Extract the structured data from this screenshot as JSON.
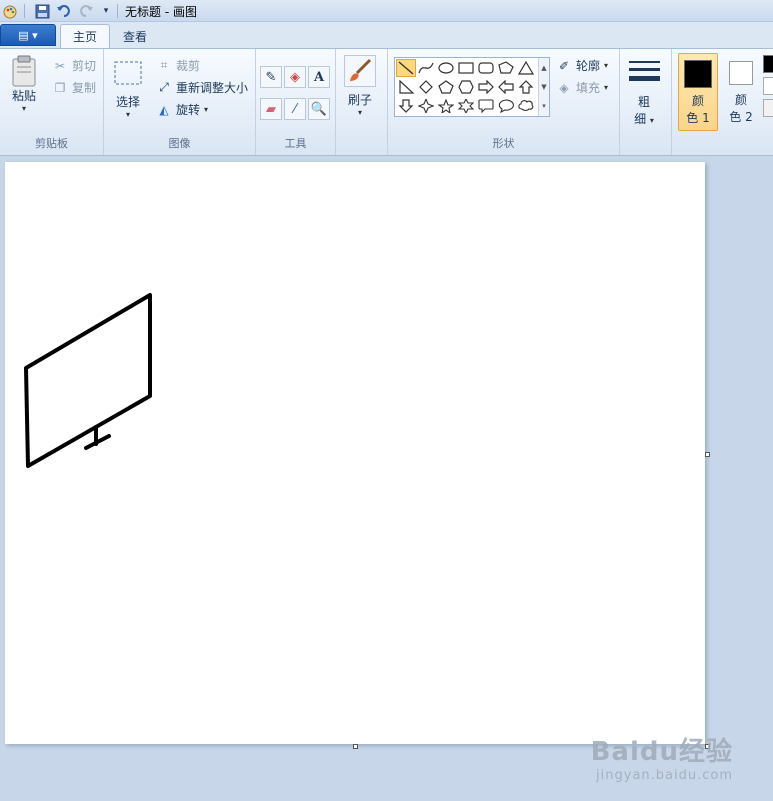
{
  "window": {
    "title": "无标题 - 画图"
  },
  "tabs": [
    {
      "label": "主页"
    },
    {
      "label": "查看"
    }
  ],
  "ribbon": {
    "clipboard": {
      "label": "剪贴板",
      "paste": "粘贴",
      "cut": "剪切",
      "copy": "复制"
    },
    "image": {
      "label": "图像",
      "select": "选择",
      "crop": "裁剪",
      "resize": "重新调整大小",
      "rotate": "旋转"
    },
    "tools": {
      "label": "工具"
    },
    "brushes": {
      "label": "刷子"
    },
    "shapes": {
      "label": "形状",
      "outline": "轮廓",
      "fill": "填充"
    },
    "size": {
      "label_line1": "粗",
      "label_line2": "细"
    },
    "color1": {
      "line1": "颜",
      "line2": "色 1",
      "value": "#000000"
    },
    "color2": {
      "line1": "颜",
      "line2": "色 2",
      "value": "#ffffff"
    }
  },
  "drawing": {
    "description_icons": [
      "monitor-drawing"
    ]
  },
  "watermark": {
    "logo": "Baidu经验",
    "url": "jingyan.baidu.com"
  }
}
